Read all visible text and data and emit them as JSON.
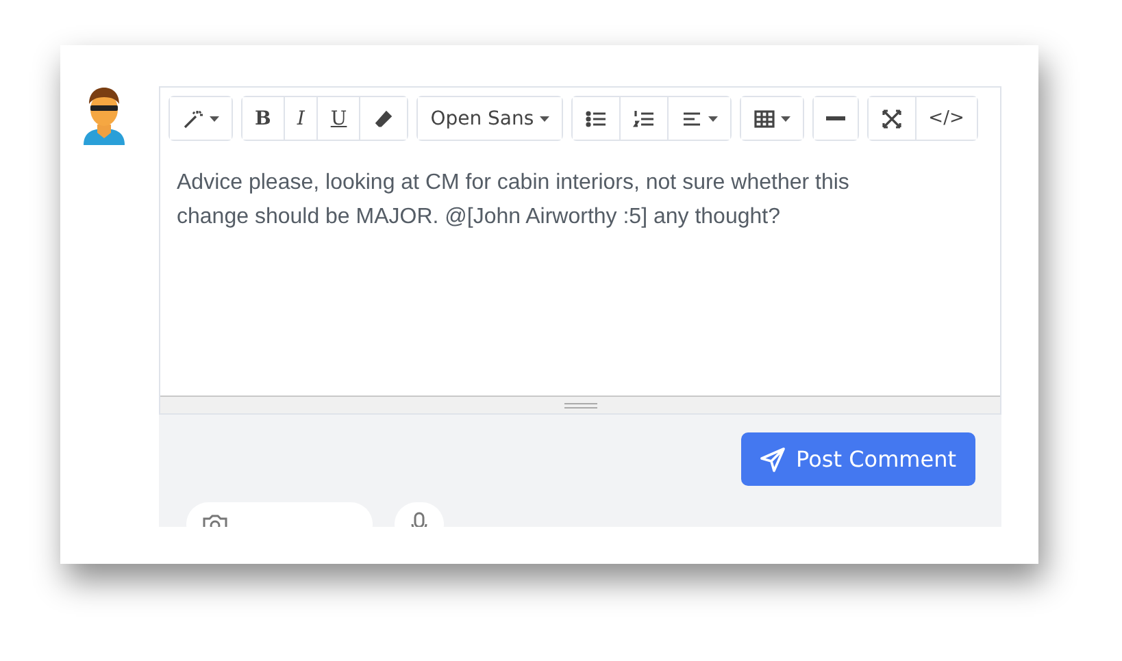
{
  "toolbar": {
    "groups": [
      {
        "items": [
          {
            "kind": "magic",
            "dropdown": true
          }
        ]
      },
      {
        "items": [
          {
            "kind": "bold",
            "label": "B"
          },
          {
            "kind": "italic",
            "label": "I"
          },
          {
            "kind": "underline",
            "label": "U"
          },
          {
            "kind": "eraser"
          }
        ]
      },
      {
        "items": [
          {
            "kind": "font",
            "label": "Open Sans",
            "dropdown": true
          }
        ]
      },
      {
        "items": [
          {
            "kind": "bullets"
          },
          {
            "kind": "numbers"
          },
          {
            "kind": "align",
            "dropdown": true
          }
        ]
      },
      {
        "items": [
          {
            "kind": "table",
            "dropdown": true
          }
        ]
      },
      {
        "items": [
          {
            "kind": "rule"
          }
        ]
      },
      {
        "items": [
          {
            "kind": "fullscreen"
          },
          {
            "kind": "code",
            "label": "</>"
          }
        ]
      }
    ]
  },
  "body": "Advice please, looking at CM for cabin interiors, not sure whether this change should be MAJOR. @[John Airworthy :5]  any thought?",
  "post_button": {
    "label": "Post Comment"
  },
  "attachments": [
    {
      "kind": "upload"
    },
    {
      "kind": "mic"
    }
  ]
}
